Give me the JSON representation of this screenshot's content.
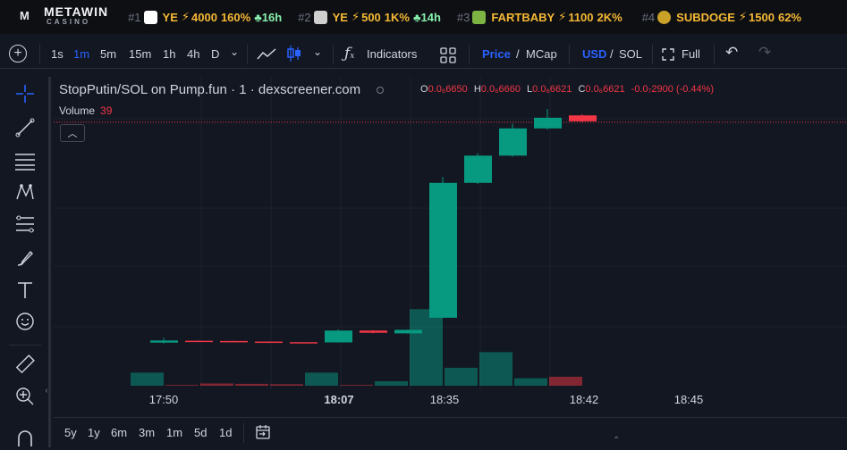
{
  "ticker": {
    "brand_name": "METAWIN",
    "brand_sub": "CASINO",
    "items": [
      {
        "rank": "#1",
        "symbol": "YE",
        "value": "4000",
        "pct": "160%",
        "age": "16h",
        "avatar_color": "#ffffff"
      },
      {
        "rank": "#2",
        "symbol": "YE",
        "value": "500",
        "pct": "1K%",
        "age": "14h",
        "avatar_color": "#cfcfcf"
      },
      {
        "rank": "#3",
        "symbol": "FARTBABY",
        "value": "1100",
        "pct": "2K%",
        "age": "",
        "avatar_color": "#7cb342"
      },
      {
        "rank": "#4",
        "symbol": "SUBDOGE",
        "value": "1500",
        "pct": "62%",
        "age": "",
        "avatar_color": "#c9a227"
      }
    ]
  },
  "toolbar": {
    "intervals": [
      "1s",
      "1m",
      "5m",
      "15m",
      "1h",
      "4h",
      "D"
    ],
    "active_interval": "1m",
    "indicators_label": "Indicators",
    "price_label": "Price",
    "mcap_label": "MCap",
    "usd_label": "USD",
    "sol_label": "SOL",
    "full_label": "Full"
  },
  "legend": {
    "title": "StopPutin/SOL on Pump.fun · 1 · dexscreener.com",
    "o_label": "O",
    "o_value": "0.0₆6650",
    "h_label": "H",
    "h_value": "0.0₆6660",
    "l_label": "L",
    "l_value": "0.0₆6621",
    "c_label": "C",
    "c_value": "0.0₆6621",
    "change": "-0.0₇2900 (-0.44%)",
    "volume_label": "Volume",
    "volume_value": "39"
  },
  "colors": {
    "up": "#089981",
    "down": "#f23645",
    "accent": "#2962ff",
    "background": "#131722"
  },
  "chart_data": {
    "type": "candlestick",
    "title": "StopPutin/SOL on Pump.fun · 1 · dexscreener.com",
    "x_ticks": [
      {
        "label": "17:50",
        "bold": false
      },
      {
        "label": "18:07",
        "bold": true
      },
      {
        "label": "18:35",
        "bold": false
      },
      {
        "label": "18:42",
        "bold": false
      },
      {
        "label": "18:45",
        "bold": false
      }
    ],
    "candles": [
      {
        "open": 10.0,
        "high": 14.0,
        "low": 9.2,
        "close": 11.8,
        "volume": 3.5
      },
      {
        "open": 11.6,
        "high": 11.8,
        "low": 11.2,
        "close": 11.4,
        "volume": 0.2
      },
      {
        "open": 11.4,
        "high": 11.6,
        "low": 10.8,
        "close": 10.9,
        "volume": 0.6
      },
      {
        "open": 10.9,
        "high": 11.0,
        "low": 10.4,
        "close": 10.5,
        "volume": 0.5
      },
      {
        "open": 10.4,
        "high": 10.6,
        "low": 10.1,
        "close": 10.2,
        "volume": 0.4
      },
      {
        "open": 10.2,
        "high": 21.0,
        "low": 10.0,
        "close": 20.2,
        "volume": 3.5
      },
      {
        "open": 20.2,
        "high": 20.6,
        "low": 17.8,
        "close": 18.3,
        "volume": 0.2
      },
      {
        "open": 17.8,
        "high": 21.2,
        "low": 17.6,
        "close": 20.8,
        "volume": 1.2
      },
      {
        "open": 31.0,
        "high": 150.0,
        "low": 30.8,
        "close": 145.0,
        "volume": 20.5
      },
      {
        "open": 145.0,
        "high": 170.0,
        "low": 144.0,
        "close": 168.0,
        "volume": 4.8
      },
      {
        "open": 168.0,
        "high": 195.0,
        "low": 167.0,
        "close": 191.0,
        "volume": 9.0
      },
      {
        "open": 191.0,
        "high": 207.5,
        "low": 190.0,
        "close": 200.0,
        "volume": 2.0
      },
      {
        "open": 202.0,
        "high": 203.0,
        "low": 196.0,
        "close": 197.0,
        "volume": 2.4
      }
    ]
  },
  "bottom": {
    "ranges": [
      "5y",
      "1y",
      "6m",
      "3m",
      "1m",
      "5d",
      "1d"
    ]
  }
}
